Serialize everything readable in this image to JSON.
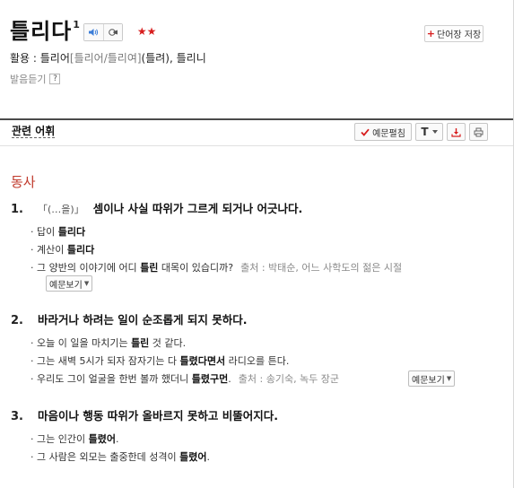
{
  "header": {
    "word": "틀리다",
    "sup": "1",
    "stars": "★★",
    "save_button": "단어장 저장"
  },
  "usage": {
    "label": "활용 : ",
    "form1": "틀리어",
    "alt": "[틀리어/틀리여]",
    "paren": "(틀려)",
    "sep": ", ",
    "form2": "틀리니"
  },
  "pronunciation": {
    "label": "발음듣기",
    "help": "?"
  },
  "related": {
    "title": "관련 어휘",
    "example_button": "예문펼침",
    "font_button": "T"
  },
  "pos": "동사",
  "senses": [
    {
      "num": "1.",
      "note": "「(…을)」",
      "def": "셈이나 사실 따위가 그르게 되거나 어긋나다.",
      "examples": [
        {
          "pre": "· 답이 ",
          "hl": "틀리다",
          "post": ""
        },
        {
          "pre": "· 계산이 ",
          "hl": "틀리다",
          "post": ""
        },
        {
          "pre": "· 그 양반의 이야기에 어디 ",
          "hl": "틀린",
          "post": " 대목이 있습디까?",
          "src": "출처 : 박태순, 어느 사학도의 젊은 시절"
        }
      ],
      "more": "예문보기"
    },
    {
      "num": "2.",
      "note": "",
      "def": "바라거나 하려는 일이 순조롭게 되지 못하다.",
      "examples": [
        {
          "pre": "· 오늘 이 일을 마치기는 ",
          "hl": "틀린",
          "post": " 것 같다."
        },
        {
          "pre": "· 그는 새벽 5시가 되자 잠자기는 다 ",
          "hl": "틀렸다면서",
          "post": " 라디오를 튼다."
        },
        {
          "pre": "· 우리도 그이 얼굴을 한번 볼까 했더니 ",
          "hl": "틀렸구먼",
          "post": ".",
          "src": "출처 : 송기숙, 녹두 장군"
        }
      ],
      "more": "예문보기"
    },
    {
      "num": "3.",
      "note": "",
      "def": "마음이나 행동 따위가 올바르지 못하고 비뚤어지다.",
      "examples": [
        {
          "pre": "· 그는 인간이 ",
          "hl": "틀렸어",
          "post": "."
        },
        {
          "pre": "· 그 사람은 외모는 출중한데 성격이 ",
          "hl": "틀렸어",
          "post": "."
        }
      ]
    }
  ],
  "colors": {
    "accent_red": "#c0392b",
    "star_red": "#d71e1e"
  },
  "icons": [
    "speaker-icon",
    "slow-speaker-icon",
    "plus-icon",
    "checkmark-icon",
    "chevron-down-icon",
    "download-icon",
    "print-icon",
    "help-icon"
  ]
}
